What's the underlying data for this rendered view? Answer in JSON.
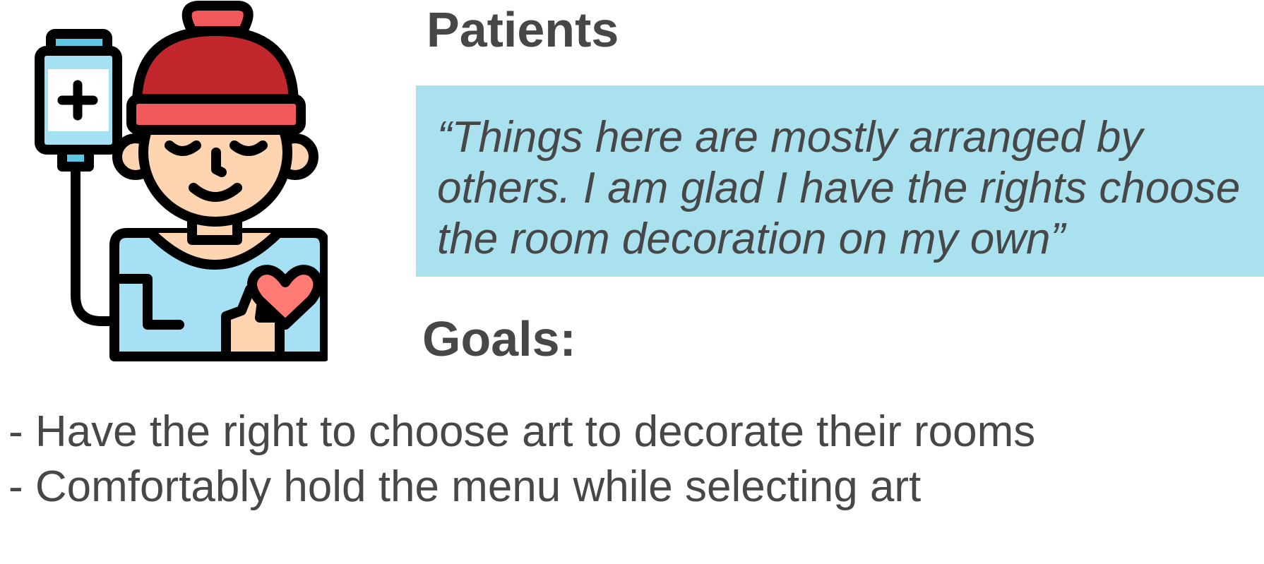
{
  "persona": {
    "illustration_icon": "patient-with-iv-drip-icon",
    "title": "Patients",
    "quote": "“Things here are mostly arranged by others. I am glad I have the rights choose the room decoration on my own”",
    "goals_heading": "Goals:",
    "goals": [
      "- Have the right to choose art to decorate their rooms",
      "- Comfortably hold the menu while selecting art"
    ]
  },
  "colors": {
    "text": "#474747",
    "quote_background": "#a9e1ef",
    "hat_red": "#c1272d",
    "hat_band": "#f15a5a",
    "skin": "#ffd4b0",
    "shirt": "#a6e0f5",
    "heart": "#ff7b73",
    "iv_bag": "#5cc6e4"
  }
}
